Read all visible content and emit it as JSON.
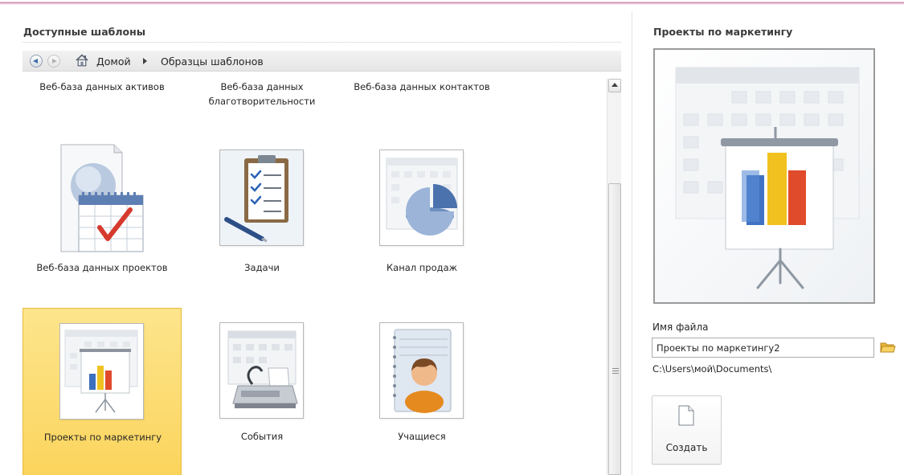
{
  "left": {
    "title": "Доступные шаблоны",
    "breadcrumb": {
      "home": "Домой",
      "current": "Образцы шаблонов"
    },
    "top_labels": [
      "Веб-база данных активов",
      "Веб-база данных благотворительности",
      "Веб-база данных контактов"
    ],
    "templates": [
      {
        "label": "Веб-база данных проектов",
        "icon": "web-project-database-icon",
        "selected": false
      },
      {
        "label": "Задачи",
        "icon": "tasks-clipboard-icon",
        "selected": false
      },
      {
        "label": "Канал продаж",
        "icon": "sales-pipeline-icon",
        "selected": false
      },
      {
        "label": "Проекты по маркетингу",
        "icon": "marketing-projects-icon",
        "selected": true
      },
      {
        "label": "События",
        "icon": "events-icon",
        "selected": false
      },
      {
        "label": "Учащиеся",
        "icon": "students-icon",
        "selected": false
      }
    ]
  },
  "right": {
    "title": "Проекты по маркетингу",
    "file_label": "Имя файла",
    "file_name": "Проекты по маркетингу2",
    "file_path": "C:\\Users\\мой\\Documents\\",
    "create_label": "Создать"
  },
  "colors": {
    "selection": "#fbd45c",
    "selection_border": "#e6bc3c",
    "accent_line": "#c77fa5"
  }
}
